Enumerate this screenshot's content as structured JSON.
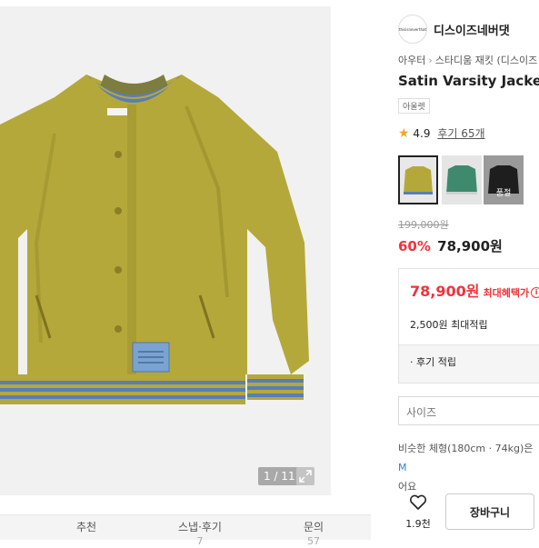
{
  "gallery": {
    "pager": "1 / 11"
  },
  "bottom_tabs": [
    {
      "label": "추천",
      "count": ""
    },
    {
      "label": "스냅·후기",
      "count": "7"
    },
    {
      "label": "문의",
      "count": "57"
    }
  ],
  "brand": {
    "name": "디스이즈네버댓",
    "logo_text": "thisisneverthat"
  },
  "breadcrumb": [
    "아우터",
    "스타디움 재킷 (디스이즈"
  ],
  "product": {
    "title": "Satin Varsity Jacket",
    "badge": "아울렛",
    "rating": "4.9",
    "reviews": "후기 65개",
    "original_price": "199,000원",
    "discount_rate": "60%",
    "price": "78,900원"
  },
  "thumbnails": [
    {
      "color": "#b5a83a",
      "selected": true,
      "soldout": ""
    },
    {
      "color": "#3f8a6e",
      "selected": false,
      "soldout": ""
    },
    {
      "color": "#1e1e1e",
      "selected": false,
      "soldout": "품절"
    }
  ],
  "benefit": {
    "price": "78,900원",
    "label": "최대혜택가",
    "points": "2,500원 최대적립",
    "review_points": "· 후기 적립"
  },
  "size": {
    "placeholder": "사이즈"
  },
  "size_note": {
    "text": "비슷한 체형(180cm · 74kg)은 ",
    "link": "M",
    "tail": "어요"
  },
  "actions": {
    "likes": "1.9천",
    "cart": "장바구니"
  },
  "colors": {
    "accent_red": "#f1333b",
    "jacket": "#b5a83a",
    "rib_blue": "#5a7db8"
  }
}
